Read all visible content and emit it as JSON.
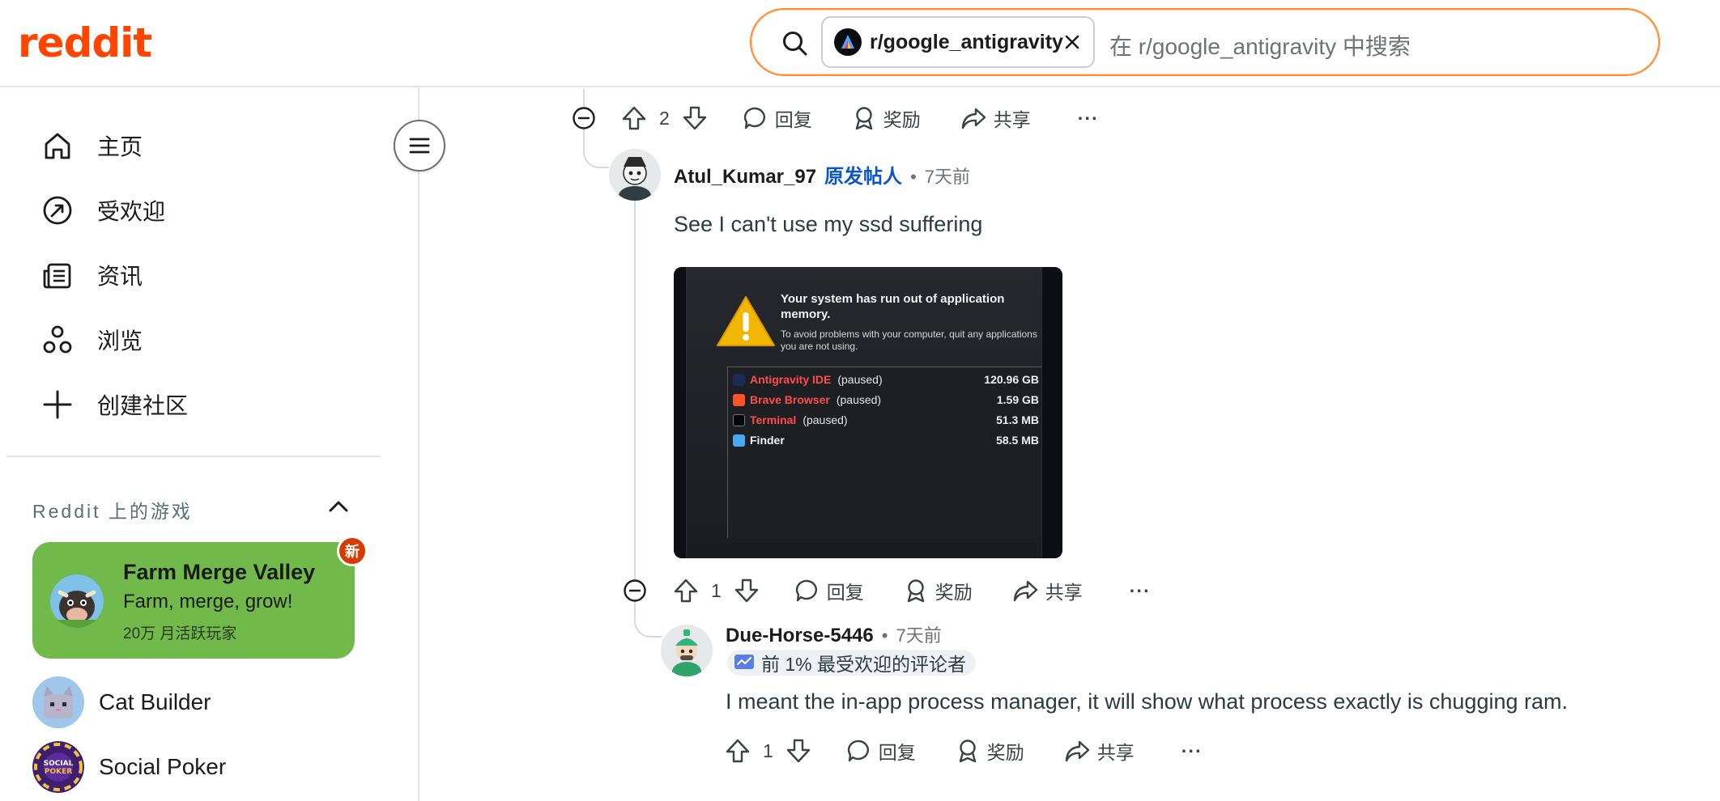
{
  "header": {
    "logo": "reddit",
    "search_chip": "r/google_antigravity",
    "search_placeholder": "在 r/google_antigravity 中搜索"
  },
  "sidebar": {
    "nav": [
      {
        "label": "主页",
        "icon": "home-icon"
      },
      {
        "label": "受欢迎",
        "icon": "popular-icon"
      },
      {
        "label": "资讯",
        "icon": "news-icon"
      },
      {
        "label": "浏览",
        "icon": "explore-icon"
      },
      {
        "label": "创建社区",
        "icon": "plus-icon"
      }
    ],
    "games_section_title": "Reddit 上的游戏",
    "featured_game": {
      "title": "Farm Merge Valley",
      "subtitle": "Farm, merge, grow!",
      "stat": "20万 月活跃玩家",
      "badge": "新",
      "color": "#72b94b"
    },
    "games": [
      {
        "label": "Cat Builder"
      },
      {
        "label": "Social Poker"
      }
    ]
  },
  "actions": {
    "reply": "回复",
    "award": "奖励",
    "share": "共享",
    "more": "···"
  },
  "comments": [
    {
      "votes": "2"
    },
    {
      "author": "Atul_Kumar_97",
      "op_tag": "原发帖人",
      "time": "7天前",
      "text": "See I can't use my ssd suffering",
      "votes": "1",
      "image": {
        "title": "Your system has run out of application memory.",
        "description": "To avoid problems with your computer, quit any applications you are not using.",
        "apps": [
          {
            "name": "Antigravity IDE",
            "state": "(paused)",
            "size": "120.96 GB"
          },
          {
            "name": "Brave Browser",
            "state": "(paused)",
            "size": "1.59 GB"
          },
          {
            "name": "Terminal",
            "state": "(paused)",
            "size": "51.3 MB"
          },
          {
            "name": "Finder",
            "state": "",
            "size": "58.5 MB"
          }
        ]
      }
    },
    {
      "author": "Due-Horse-5446",
      "time": "7天前",
      "flair": "前 1% 最受欢迎的评论者",
      "text": "I meant the in-app process manager, it will show what process exactly is chugging ram.",
      "votes": "1"
    }
  ],
  "colors": {
    "brand": "#ff4500",
    "op_blue": "#0a55c7",
    "new_badge": "#d93a00"
  }
}
